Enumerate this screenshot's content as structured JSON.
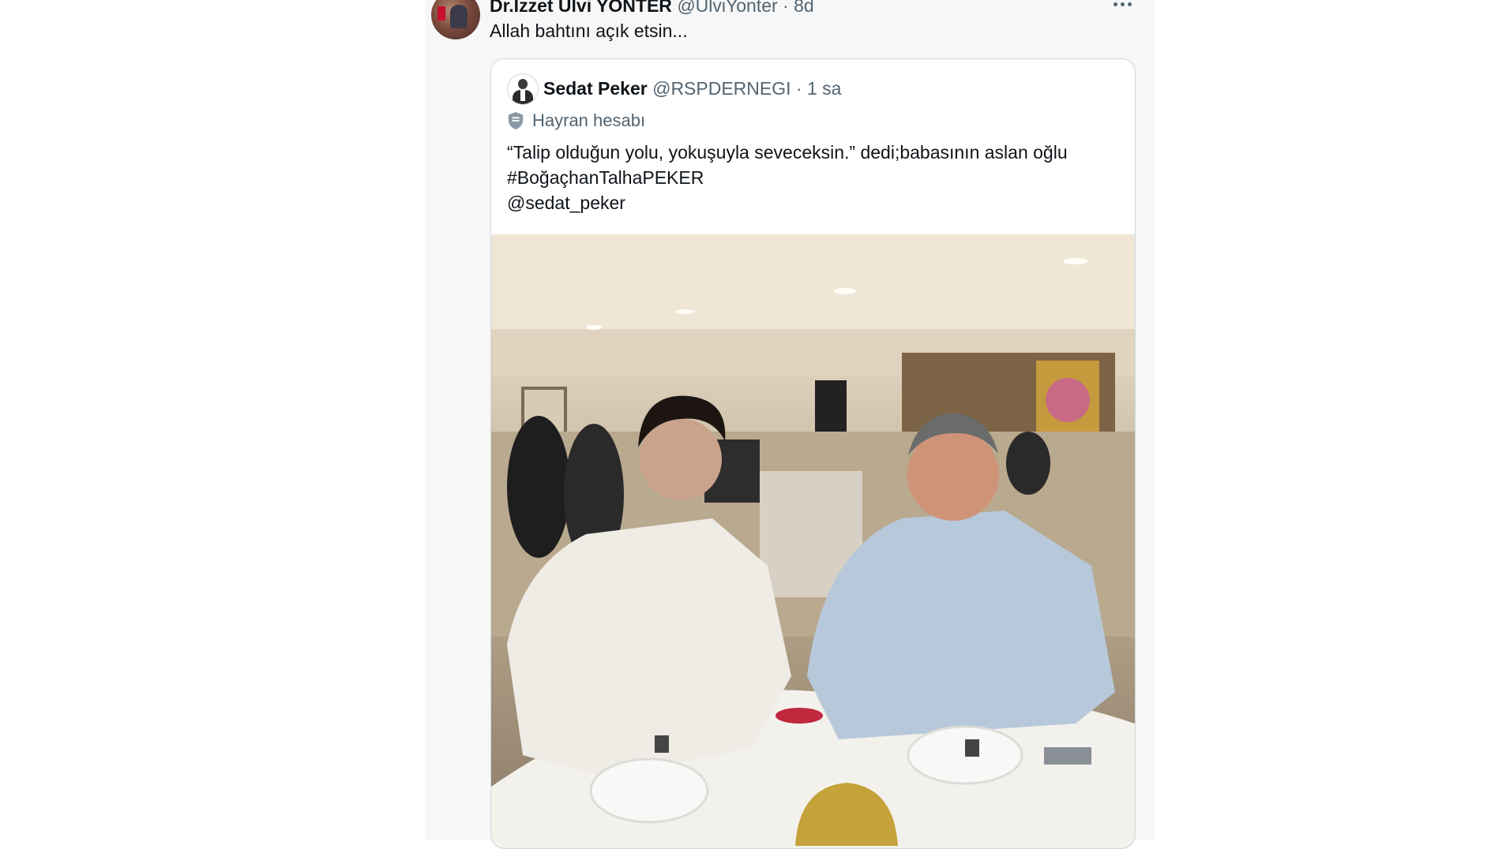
{
  "post": {
    "author_name": "Dr.İzzet Ulvi YÖNTER",
    "author_handle": "@UlviYonter",
    "separator": "·",
    "time": "8d",
    "text": "Allah bahtını açık etsin..."
  },
  "quote": {
    "author_name": "Sedat Peker",
    "author_handle": "@RSPDERNEGI",
    "separator": "·",
    "time": "1 sa",
    "badge_icon": "shield-icon",
    "badge_label": "Hayran hesabı",
    "lines": [
      "“Talip olduğun yolu, yokuşuyla seveceksin.” dedi;babasının aslan oğlu",
      "#BoğaçhanTalhaPEKER",
      "@sedat_peker"
    ]
  },
  "icons": {
    "more": "more-icon"
  },
  "colors": {
    "text_primary": "#0f1419",
    "text_secondary": "#536471",
    "border": "#cfd9de"
  }
}
